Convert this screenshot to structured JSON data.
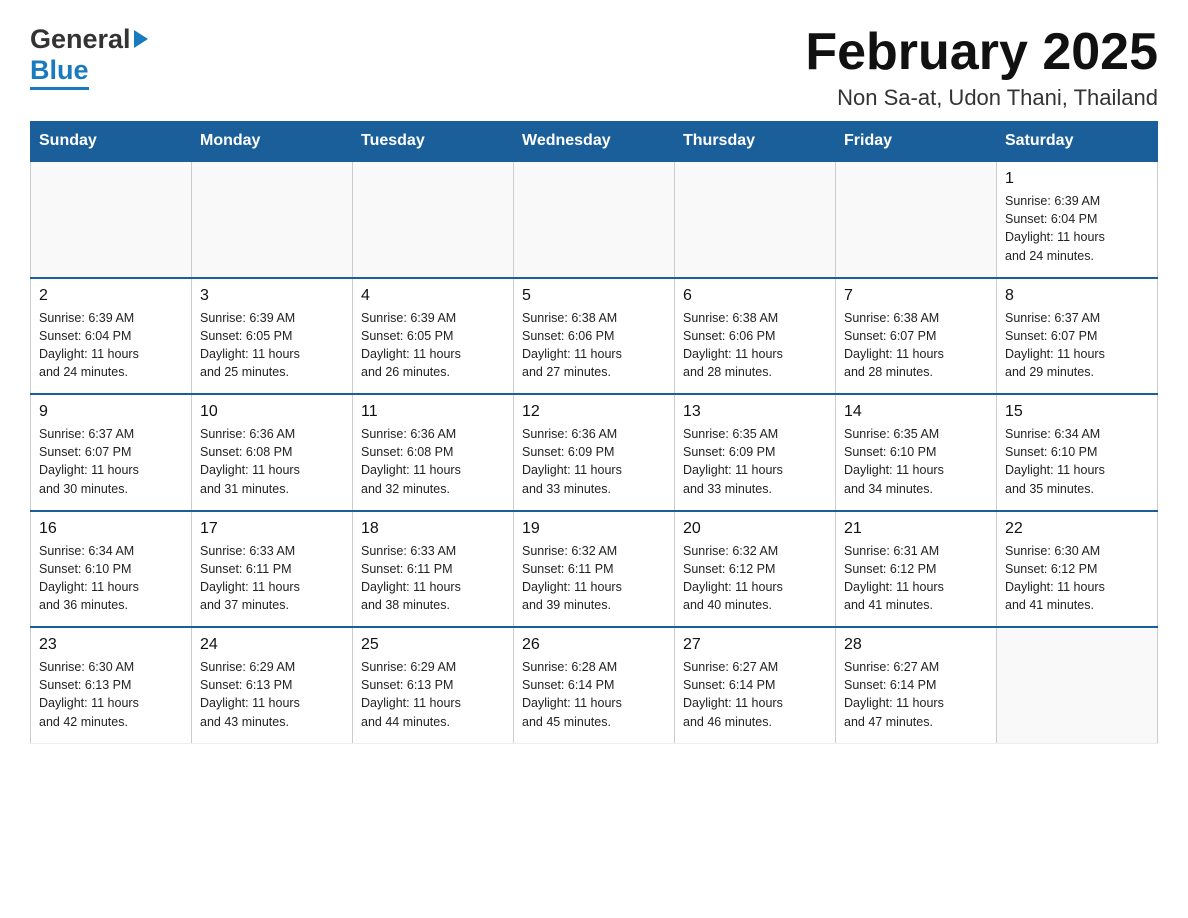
{
  "header": {
    "logo": {
      "part1": "General",
      "part2": "Blue"
    },
    "title": "February 2025",
    "subtitle": "Non Sa-at, Udon Thani, Thailand"
  },
  "calendar": {
    "days_of_week": [
      "Sunday",
      "Monday",
      "Tuesday",
      "Wednesday",
      "Thursday",
      "Friday",
      "Saturday"
    ],
    "weeks": [
      [
        {
          "day": "",
          "info": ""
        },
        {
          "day": "",
          "info": ""
        },
        {
          "day": "",
          "info": ""
        },
        {
          "day": "",
          "info": ""
        },
        {
          "day": "",
          "info": ""
        },
        {
          "day": "",
          "info": ""
        },
        {
          "day": "1",
          "info": "Sunrise: 6:39 AM\nSunset: 6:04 PM\nDaylight: 11 hours\nand 24 minutes."
        }
      ],
      [
        {
          "day": "2",
          "info": "Sunrise: 6:39 AM\nSunset: 6:04 PM\nDaylight: 11 hours\nand 24 minutes."
        },
        {
          "day": "3",
          "info": "Sunrise: 6:39 AM\nSunset: 6:05 PM\nDaylight: 11 hours\nand 25 minutes."
        },
        {
          "day": "4",
          "info": "Sunrise: 6:39 AM\nSunset: 6:05 PM\nDaylight: 11 hours\nand 26 minutes."
        },
        {
          "day": "5",
          "info": "Sunrise: 6:38 AM\nSunset: 6:06 PM\nDaylight: 11 hours\nand 27 minutes."
        },
        {
          "day": "6",
          "info": "Sunrise: 6:38 AM\nSunset: 6:06 PM\nDaylight: 11 hours\nand 28 minutes."
        },
        {
          "day": "7",
          "info": "Sunrise: 6:38 AM\nSunset: 6:07 PM\nDaylight: 11 hours\nand 28 minutes."
        },
        {
          "day": "8",
          "info": "Sunrise: 6:37 AM\nSunset: 6:07 PM\nDaylight: 11 hours\nand 29 minutes."
        }
      ],
      [
        {
          "day": "9",
          "info": "Sunrise: 6:37 AM\nSunset: 6:07 PM\nDaylight: 11 hours\nand 30 minutes."
        },
        {
          "day": "10",
          "info": "Sunrise: 6:36 AM\nSunset: 6:08 PM\nDaylight: 11 hours\nand 31 minutes."
        },
        {
          "day": "11",
          "info": "Sunrise: 6:36 AM\nSunset: 6:08 PM\nDaylight: 11 hours\nand 32 minutes."
        },
        {
          "day": "12",
          "info": "Sunrise: 6:36 AM\nSunset: 6:09 PM\nDaylight: 11 hours\nand 33 minutes."
        },
        {
          "day": "13",
          "info": "Sunrise: 6:35 AM\nSunset: 6:09 PM\nDaylight: 11 hours\nand 33 minutes."
        },
        {
          "day": "14",
          "info": "Sunrise: 6:35 AM\nSunset: 6:10 PM\nDaylight: 11 hours\nand 34 minutes."
        },
        {
          "day": "15",
          "info": "Sunrise: 6:34 AM\nSunset: 6:10 PM\nDaylight: 11 hours\nand 35 minutes."
        }
      ],
      [
        {
          "day": "16",
          "info": "Sunrise: 6:34 AM\nSunset: 6:10 PM\nDaylight: 11 hours\nand 36 minutes."
        },
        {
          "day": "17",
          "info": "Sunrise: 6:33 AM\nSunset: 6:11 PM\nDaylight: 11 hours\nand 37 minutes."
        },
        {
          "day": "18",
          "info": "Sunrise: 6:33 AM\nSunset: 6:11 PM\nDaylight: 11 hours\nand 38 minutes."
        },
        {
          "day": "19",
          "info": "Sunrise: 6:32 AM\nSunset: 6:11 PM\nDaylight: 11 hours\nand 39 minutes."
        },
        {
          "day": "20",
          "info": "Sunrise: 6:32 AM\nSunset: 6:12 PM\nDaylight: 11 hours\nand 40 minutes."
        },
        {
          "day": "21",
          "info": "Sunrise: 6:31 AM\nSunset: 6:12 PM\nDaylight: 11 hours\nand 41 minutes."
        },
        {
          "day": "22",
          "info": "Sunrise: 6:30 AM\nSunset: 6:12 PM\nDaylight: 11 hours\nand 41 minutes."
        }
      ],
      [
        {
          "day": "23",
          "info": "Sunrise: 6:30 AM\nSunset: 6:13 PM\nDaylight: 11 hours\nand 42 minutes."
        },
        {
          "day": "24",
          "info": "Sunrise: 6:29 AM\nSunset: 6:13 PM\nDaylight: 11 hours\nand 43 minutes."
        },
        {
          "day": "25",
          "info": "Sunrise: 6:29 AM\nSunset: 6:13 PM\nDaylight: 11 hours\nand 44 minutes."
        },
        {
          "day": "26",
          "info": "Sunrise: 6:28 AM\nSunset: 6:14 PM\nDaylight: 11 hours\nand 45 minutes."
        },
        {
          "day": "27",
          "info": "Sunrise: 6:27 AM\nSunset: 6:14 PM\nDaylight: 11 hours\nand 46 minutes."
        },
        {
          "day": "28",
          "info": "Sunrise: 6:27 AM\nSunset: 6:14 PM\nDaylight: 11 hours\nand 47 minutes."
        },
        {
          "day": "",
          "info": ""
        }
      ]
    ]
  }
}
